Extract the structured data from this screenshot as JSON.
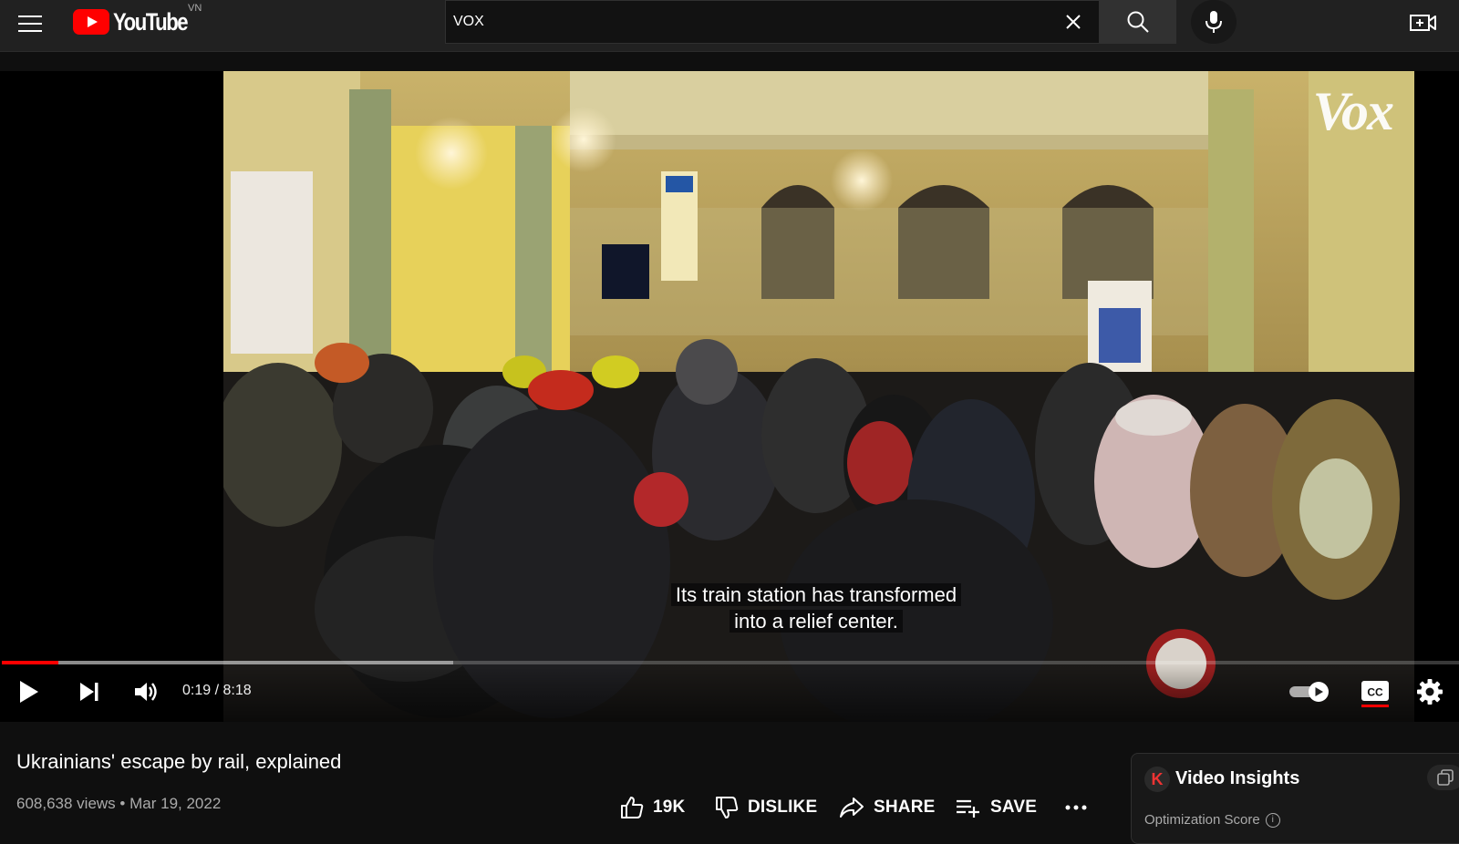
{
  "masthead": {
    "logo_text": "YouTube",
    "country_code": "VN",
    "search": {
      "value": "VOX",
      "placeholder": "Search"
    }
  },
  "player": {
    "watermark": "Vox",
    "caption_line1": "Its train station has transformed",
    "caption_line2": "into a relief center.",
    "time_display": "0:19 / 8:18",
    "progress_played_fraction": 0.0388,
    "progress_buffered_fraction": 0.31,
    "autoplay": "on",
    "captions": "on"
  },
  "video": {
    "title": "Ukrainians' escape by rail, explained",
    "views": "608,638 views",
    "separator": "•",
    "date": "Mar 19, 2022"
  },
  "actions": {
    "like_count": "19K",
    "dislike_label": "DISLIKE",
    "share_label": "SHARE",
    "save_label": "SAVE"
  },
  "insights": {
    "logo_letter": "K",
    "title": "Video Insights",
    "subtitle": "Optimization Score"
  },
  "colors": {
    "brand_red": "#ff0000",
    "masthead_bg": "#212121",
    "page_bg": "#0f0f0f"
  }
}
